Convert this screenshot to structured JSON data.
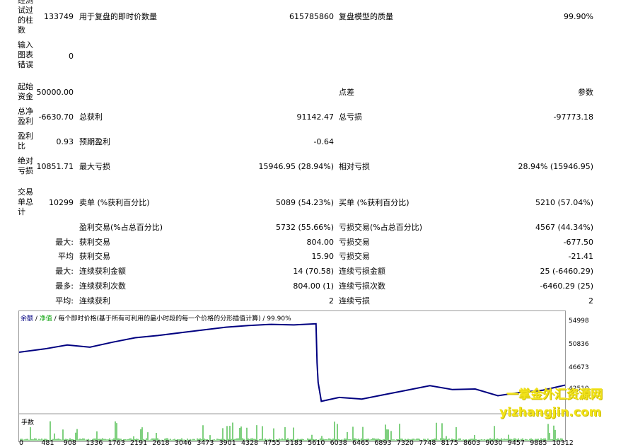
{
  "stats": {
    "bars_tested": {
      "label": "经测试过的柱数",
      "value": "133749"
    },
    "ticks_modelled": {
      "label": "用于复盘的即时价数量",
      "value": "615785860"
    },
    "modelling_quality": {
      "label": "复盘模型的质量",
      "value": "99.90%"
    },
    "mismatched_errors": {
      "label": "输入图表错误",
      "value": "0"
    },
    "initial_deposit": {
      "label": "起始资金",
      "value": "50000.00"
    },
    "spread": {
      "label": "点差",
      "value": "参数"
    },
    "total_net_profit": {
      "label": "总净盈利",
      "value": "-6630.70"
    },
    "gross_profit": {
      "label": "总获利",
      "value": "91142.47"
    },
    "gross_loss": {
      "label": "总亏损",
      "value": "-97773.18"
    },
    "profit_factor": {
      "label": "盈利比",
      "value": "0.93"
    },
    "expected_payoff": {
      "label": "预期盈利",
      "value": "-0.64"
    },
    "absolute_drawdown": {
      "label": "绝对亏损",
      "value": "10851.71"
    },
    "maximal_drawdown": {
      "label": "最大亏损",
      "value": "15946.95 (28.94%)"
    },
    "relative_drawdown": {
      "label": "相对亏损",
      "value": "28.94% (15946.95)"
    },
    "total_trades": {
      "label": "交易单总计",
      "value": "10299"
    },
    "short_positions": {
      "label": "卖单 (%获利百分比)",
      "value": "5089 (54.23%)"
    },
    "long_positions": {
      "label": "买单 (%获利百分比)",
      "value": "5210 (57.04%)"
    },
    "profit_trades": {
      "label": "盈利交易(%占总百分比)",
      "value": "5732 (55.66%)"
    },
    "loss_trades": {
      "label": "亏损交易(%占总百分比)",
      "value": "4567 (44.34%)"
    },
    "largest": {
      "prefix": "最大:",
      "profit_label": "获利交易",
      "profit_value": "804.00",
      "loss_label": "亏损交易",
      "loss_value": "-677.50"
    },
    "average": {
      "prefix": "平均",
      "profit_label": "获利交易",
      "profit_value": "15.90",
      "loss_label": "亏损交易",
      "loss_value": "-21.41"
    },
    "max_consecutive": {
      "prefix": "最大:",
      "wins_label": "连续获利金额",
      "wins_value": "14 (70.58)",
      "losses_label": "连续亏损金额",
      "losses_value": "25 (-6460.29)"
    },
    "maximal_consecutive": {
      "prefix": "最多:",
      "profit_label": "连续获利次数",
      "profit_value": "804.00 (1)",
      "loss_label": "连续亏损次数",
      "loss_value": "-6460.29 (25)"
    },
    "average_consecutive": {
      "prefix": "平均:",
      "wins_label": "连续获利",
      "wins_value": "2",
      "losses_label": "连续亏损",
      "losses_value": "2"
    }
  },
  "chart": {
    "legend_balance": "余额",
    "legend_sep1": " / ",
    "legend_equity": "净值",
    "legend_rest": " / 每个即时价格(基于所有可利用的最小时段的每一个价格的分形插值计算) / 99.90%",
    "volume_label": "手数",
    "balance_color": "#000080",
    "volume_color": "#00a000",
    "price_ticks": [
      "54998",
      "50836",
      "46673",
      "42510"
    ],
    "x_ticks": [
      "0",
      "481",
      "908",
      "1336",
      "1763",
      "2191",
      "2618",
      "3046",
      "3473",
      "3901",
      "4328",
      "4755",
      "5183",
      "5610",
      "6038",
      "6465",
      "6893",
      "7320",
      "7748",
      "8175",
      "8603",
      "9030",
      "9457",
      "9885",
      "10312"
    ]
  },
  "chart_data": {
    "type": "line",
    "title": "",
    "xlabel": "",
    "ylabel": "",
    "xlim": [
      0,
      10299
    ],
    "ylim": [
      39500,
      56500
    ],
    "series": [
      {
        "name": "余额",
        "x": [
          0,
          481,
          908,
          1336,
          1763,
          2191,
          2618,
          3046,
          3473,
          3901,
          4328,
          4755,
          5183,
          5600,
          5620,
          5640,
          5700,
          6038,
          6465,
          6893,
          7320,
          7748,
          8175,
          8603,
          9030,
          9457,
          9885,
          10299
        ],
        "y": [
          49900,
          50500,
          51200,
          50800,
          51700,
          52500,
          52900,
          53400,
          53900,
          54400,
          54700,
          54900,
          54800,
          55000,
          48000,
          44500,
          41100,
          41800,
          41500,
          42300,
          43100,
          43900,
          43200,
          43300,
          42100,
          42700,
          43100,
          44000
        ]
      }
    ]
  },
  "watermark": {
    "line1": "一掌金外汇资源网",
    "line2": "yizhangjin.com"
  }
}
